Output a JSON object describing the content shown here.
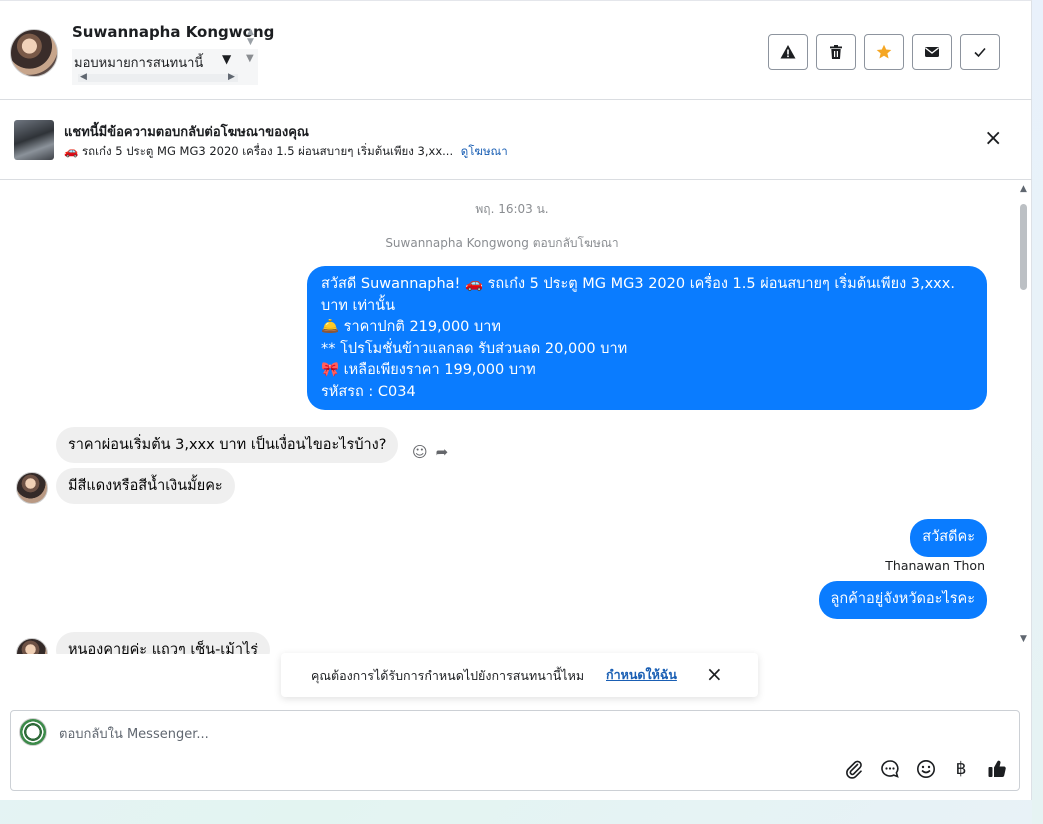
{
  "header": {
    "contact_name": "Suwannapha Kongwong",
    "assign_label": "มอบหมายการสนทนานี้",
    "actions": [
      {
        "name": "warning",
        "icon": "alert-triangle-icon"
      },
      {
        "name": "delete",
        "icon": "trash-icon"
      },
      {
        "name": "star",
        "icon": "star-icon"
      },
      {
        "name": "mark-unread",
        "icon": "envelope-icon"
      },
      {
        "name": "done",
        "icon": "check-icon"
      }
    ]
  },
  "ad_banner": {
    "title": "แชทนี้มีข้อความตอบกลับต่อโฆษณาของคุณ",
    "subtitle": "🚗 รถเก๋ง 5 ประตู MG MG3 2020 เครื่อง 1.5 ผ่อนสบายๆ เริ่มต้นเพียง 3,xx...",
    "link": "ดูโฆษณา",
    "close": "×"
  },
  "conversation": {
    "timestamp": "พฤ. 16:03 น.",
    "reply_note": "Suwannapha Kongwong ตอบกลับโฆษณา",
    "outgoing_message_lines": [
      "สวัสดี Suwannapha! 🚗 รถเก๋ง 5 ประตู MG MG3 2020 เครื่อง 1.5 ผ่อนสบายๆ เริ่มต้นเพียง 3,xxx.",
      "บาท เท่านั้น",
      "🛎️ ราคาปกติ 219,000 บาท",
      "** โปรโมชั่นข้าวแลกลด รับส่วนลด 20,000 บาท",
      "🎀  เหลือเพียงราคา 199,000 บาท",
      " รหัสรถ : C034"
    ],
    "incoming_1": "ราคาผ่อนเริ่มต้น 3,xxx บาท เป็นเงื่อนไขอะไรบ้าง?",
    "incoming_2": "มีสีแดงหรือสีน้ำเงินมั้ยคะ",
    "outgoing_2": "สวัสดีคะ",
    "sender": "Thanawan Thon",
    "outgoing_3": "ลูกค้าอยู่จังหวัดอะไรคะ",
    "incoming_3": "หนองคายค่ะ แถวๆ เซ็น-เม้าไร่"
  },
  "toast": {
    "text": "คุณต้องการได้รับการกำหนดไปยังการสนทนานี้ไหม",
    "link": "กำหนดให้ฉัน",
    "close": "×"
  },
  "composer": {
    "placeholder": "ตอบกลับใน Messenger...",
    "currency_symbol": "฿",
    "tools": [
      "paperclip-icon",
      "chat-bubble-icon",
      "emoji-icon",
      "baht-icon",
      "thumbs-up-icon"
    ]
  },
  "colors": {
    "outgoing_bubble": "#0a7cff",
    "incoming_bubble": "#efefef",
    "star": "#f5a623",
    "link": "#1a5fb4"
  }
}
